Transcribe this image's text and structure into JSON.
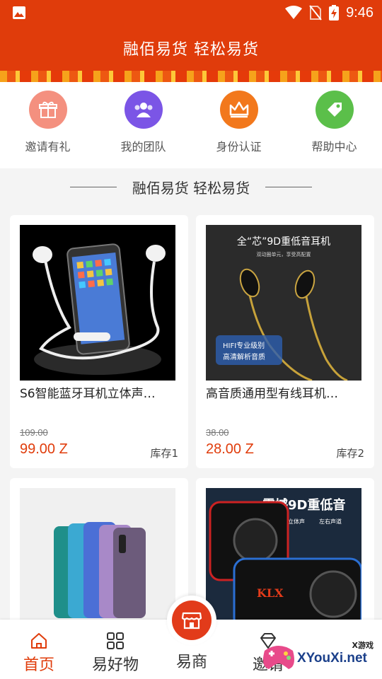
{
  "status_bar": {
    "time": "9:46"
  },
  "header": {
    "title": "融佰易货 轻松易货"
  },
  "quick_nav": [
    {
      "label": "邀请有礼",
      "icon": "gift-icon",
      "color": "#f36d5a"
    },
    {
      "label": "我的团队",
      "icon": "team-icon",
      "color": "#7b55e6"
    },
    {
      "label": "身份认证",
      "icon": "crown-icon",
      "color": "#f2781c"
    },
    {
      "label": "帮助中心",
      "icon": "tag-icon",
      "color": "#5bbf4a"
    }
  ],
  "section": {
    "title": "融佰易货 轻松易货"
  },
  "products": [
    {
      "name": "S6智能蓝牙耳机立体声…",
      "old_price": "109.00",
      "price": "99.00 Z",
      "stock": "库存1"
    },
    {
      "name": "高音质通用型有线耳机…",
      "old_price": "38.00",
      "price": "28.00 Z",
      "stock": "库存2",
      "image_text": [
        "全“芯”9D重低音耳机",
        "双动圈单元，享受高配置",
        "HIFI专业级别",
        "高清解析音质"
      ]
    },
    {
      "name": "",
      "old_price": "",
      "price": "",
      "stock": ""
    },
    {
      "name": "",
      "old_price": "",
      "price": "",
      "stock": "",
      "image_text": [
        "震撼9D重低音",
        "环绕立体声",
        "左右声道",
        "KLX"
      ]
    }
  ],
  "tabbar": {
    "items": [
      {
        "label": "首页",
        "icon": "home-icon",
        "active": true
      },
      {
        "label": "易好物",
        "icon": "grid-icon",
        "active": false
      },
      {
        "label": "易商",
        "icon": "shop-icon",
        "active": false
      },
      {
        "label": "邀请",
        "icon": "diamond-icon",
        "active": false
      }
    ]
  },
  "watermark": {
    "small": "X游戏",
    "big": "XYouXi.net"
  },
  "colors": {
    "primary": "#e03c0b",
    "background": "#f4f4f4"
  }
}
